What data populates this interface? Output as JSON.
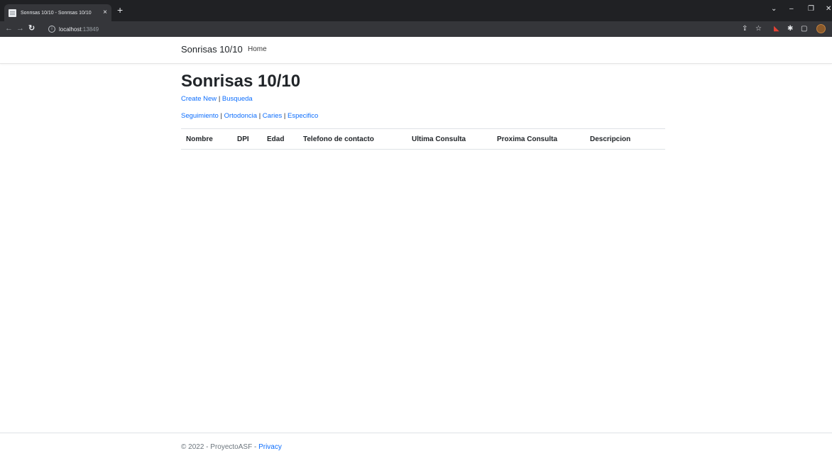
{
  "browser": {
    "tab_title": "Sonrisas 10/10 - Sonrisas 10/10",
    "tab_close": "×",
    "new_tab": "+",
    "url_host": "localhost",
    "url_port": ":13849",
    "icons": {
      "back": "back-arrow-icon",
      "forward": "forward-arrow-icon",
      "reload": "reload-icon",
      "info": "info-icon",
      "share": "share-icon",
      "bookmark": "star-icon",
      "extension_red": "extension-icon",
      "extensions": "puzzle-icon",
      "sidepanel": "side-panel-icon",
      "profile": "profile-avatar-icon",
      "minimize": "minimize-icon",
      "restore": "restore-icon",
      "close": "close-icon",
      "tab_search": "chevron-down-icon"
    }
  },
  "navbar": {
    "brand": "Sonrisas 10/10",
    "links": [
      "Home"
    ]
  },
  "main": {
    "title": "Sonrisas 10/10",
    "actions": [
      "Create New",
      "Busqueda"
    ],
    "filters": [
      "Seguimiento",
      "Ortodoncia",
      "Caries",
      "Especifico"
    ],
    "separator": "|",
    "table": {
      "columns": [
        "Nombre",
        "DPI",
        "Edad",
        "Telefono de contacto",
        "Ultima Consulta",
        "Proxima Consulta",
        "Descripcion"
      ],
      "rows": []
    }
  },
  "footer": {
    "prefix": "© 2022 - ProyectoASF - ",
    "privacy": "Privacy"
  },
  "colors": {
    "link": "#0d6efd",
    "chrome_dark": "#202124",
    "toolbar": "#35363a",
    "text": "#212529"
  }
}
